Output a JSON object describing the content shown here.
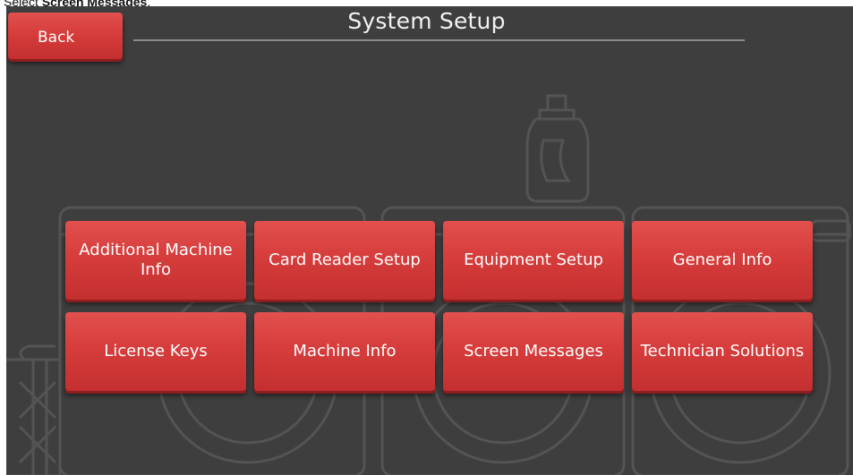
{
  "instruction": {
    "prefix": "Select ",
    "target": "Screen Messages",
    "suffix": "."
  },
  "screen": {
    "title": "System Setup",
    "back_label": "Back",
    "buttons": [
      {
        "label": "Additional Machine Info"
      },
      {
        "label": "Card Reader Setup"
      },
      {
        "label": "Equipment Setup"
      },
      {
        "label": "General Info"
      },
      {
        "label": "License Keys"
      },
      {
        "label": "Machine Info"
      },
      {
        "label": "Screen Messages"
      },
      {
        "label": "Technician Solutions"
      }
    ]
  },
  "colors": {
    "background": "#3e3e3e",
    "button_red": "#d63d3c",
    "button_shadow": "#8e1d1f",
    "text": "#ffffff"
  }
}
